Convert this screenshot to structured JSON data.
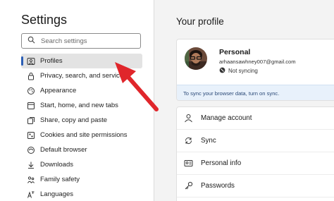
{
  "sidebar": {
    "title": "Settings",
    "search_placeholder": "Search settings",
    "items": [
      {
        "label": "Profiles",
        "icon": "profile-icon",
        "active": true
      },
      {
        "label": "Privacy, search, and services",
        "icon": "lock-icon"
      },
      {
        "label": "Appearance",
        "icon": "appearance-icon"
      },
      {
        "label": "Start, home, and new tabs",
        "icon": "home-tabs-icon"
      },
      {
        "label": "Share, copy and paste",
        "icon": "share-icon"
      },
      {
        "label": "Cookies and site permissions",
        "icon": "cookies-icon"
      },
      {
        "label": "Default browser",
        "icon": "browser-icon"
      },
      {
        "label": "Downloads",
        "icon": "download-icon"
      },
      {
        "label": "Family safety",
        "icon": "family-icon"
      },
      {
        "label": "Languages",
        "icon": "languages-icon"
      }
    ]
  },
  "main": {
    "title": "Your profile",
    "profile": {
      "name": "Personal",
      "email": "arhaansawhney007@gmail.com",
      "sync_status": "Not syncing",
      "sync_banner": "To sync your browser data, turn on sync."
    },
    "menu": [
      {
        "label": "Manage account",
        "icon": "person-icon"
      },
      {
        "label": "Sync",
        "icon": "sync-icon"
      },
      {
        "label": "Personal info",
        "icon": "personal-info-icon"
      },
      {
        "label": "Passwords",
        "icon": "key-icon"
      }
    ]
  },
  "colors": {
    "accent": "#2b5eb5",
    "annotation_arrow": "#e0262b",
    "main_bg": "#f3f3f3"
  }
}
